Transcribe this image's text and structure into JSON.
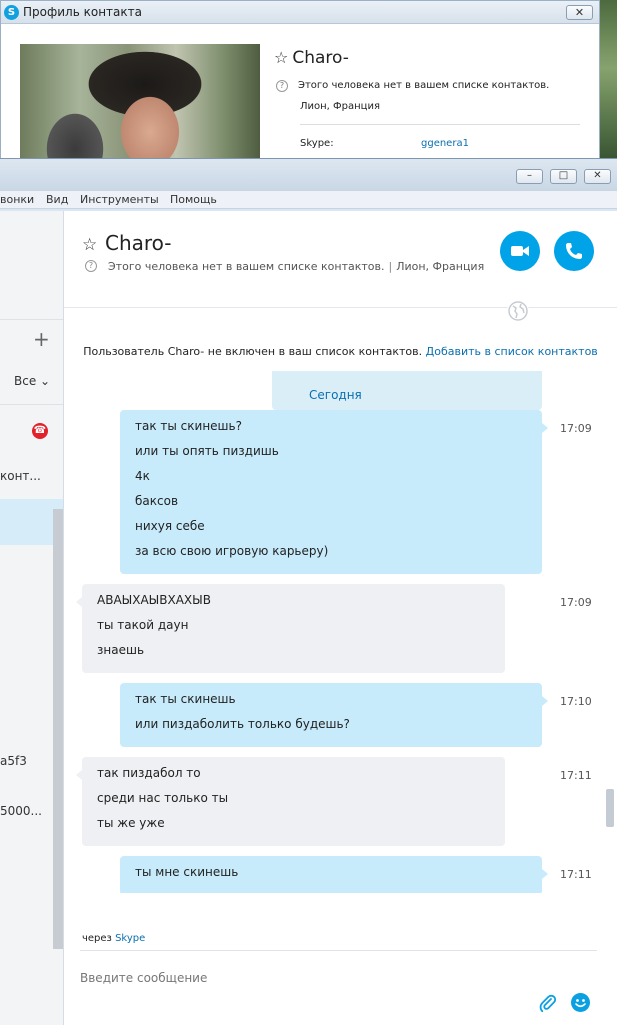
{
  "profile_window": {
    "title": "Профиль контакта",
    "close_label": "✕",
    "contact_name": "Charo-",
    "status": "Этого человека нет в вашем списке контактов.",
    "location": "Лион, Франция",
    "skype_label": "Skype:",
    "skype_value": "ggenera1"
  },
  "main_window": {
    "window_buttons": {
      "minimize": "–",
      "maximize": "□",
      "close": "✕"
    },
    "menu": [
      "вонки",
      "Вид",
      "Инструменты",
      "Помощь"
    ]
  },
  "sidebar": {
    "add_label": "+",
    "filter_label": "Все ⌄",
    "rows": [
      "конт...",
      "a5f3",
      "5000..."
    ]
  },
  "chat_header": {
    "contact_name": "Charo-",
    "status": "Этого человека нет в вашем списке контактов.",
    "separator": "|",
    "location": "Лион, Франция"
  },
  "notice": {
    "text": "Пользователь Charo- не включен в ваш список контактов.",
    "link": "Добавить в список контактов"
  },
  "today_label": "Сегодня",
  "messages": [
    {
      "direction": "out",
      "time": "17:09",
      "lines": [
        "так ты скинешь?",
        "или ты опять пиздишь",
        "4к",
        "баксов",
        "нихуя себе",
        "за всю свою игровую карьеру)"
      ]
    },
    {
      "direction": "in",
      "time": "17:09",
      "lines": [
        "АВАЫХАЫВХАХЫВ",
        "ты такой даун",
        "знаешь"
      ]
    },
    {
      "direction": "out",
      "time": "17:10",
      "lines": [
        "так ты скинешь",
        "или пиздаболить только будешь?"
      ]
    },
    {
      "direction": "in",
      "time": "17:11",
      "lines": [
        "так пиздабол то",
        "среди нас только ты",
        "ты же уже"
      ]
    },
    {
      "direction": "out",
      "time": "17:11",
      "lines": [
        "ты мне скинешь"
      ]
    }
  ],
  "footer": {
    "via_prefix": "через",
    "via_link": "Skype",
    "input_placeholder": "Введите сообщение"
  },
  "colors": {
    "accent": "#00a2e8",
    "outgoing_bubble": "#c7ebfb",
    "incoming_bubble": "#eef0f3",
    "link": "#0a6fb0",
    "end_call": "#e2212b"
  },
  "icons": [
    "skype-logo-icon",
    "star-icon",
    "question-icon",
    "video-camera-icon",
    "phone-icon",
    "globe-icon",
    "end-call-icon",
    "plus-icon",
    "paperclip-icon",
    "emoji-icon"
  ]
}
